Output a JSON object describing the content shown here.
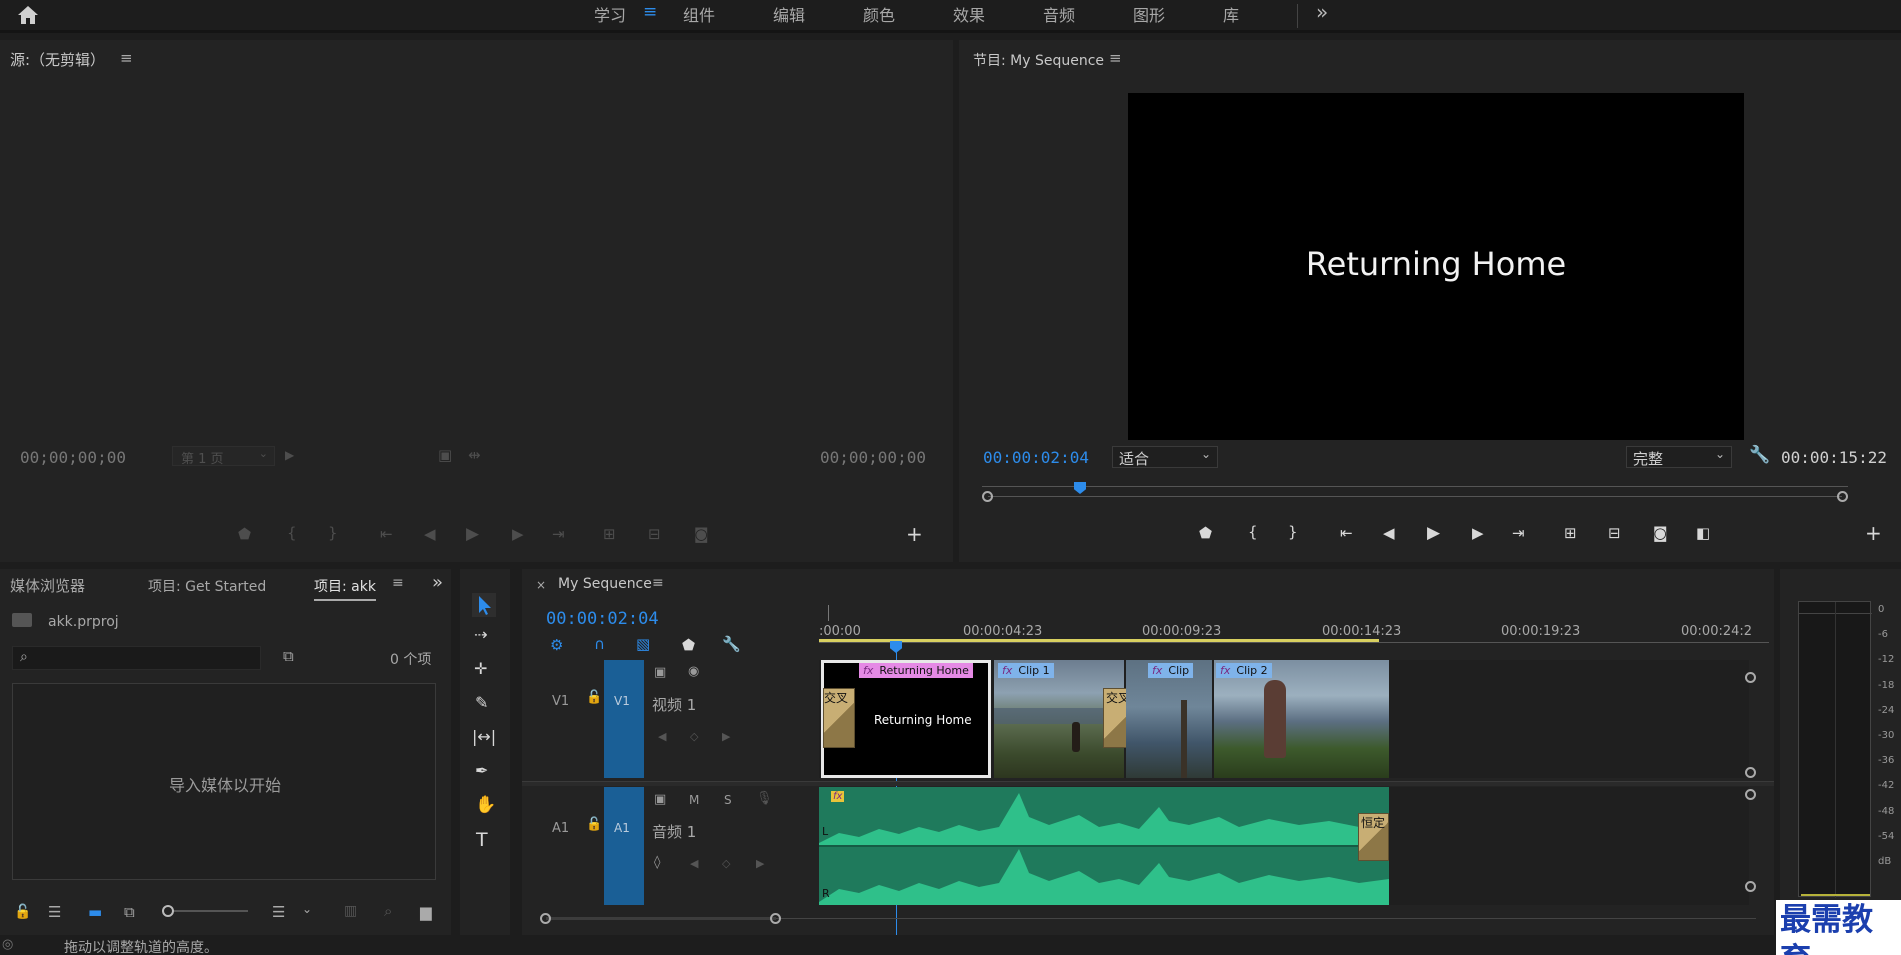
{
  "topbar": {
    "workspaces": [
      "学习",
      "组件",
      "编辑",
      "颜色",
      "效果",
      "音频",
      "图形",
      "库"
    ],
    "active_workspace": "学习",
    "overflow": "»"
  },
  "source_panel": {
    "title": "源:（无剪辑）",
    "timecode_in": "00;00;00;00",
    "page_select": "第 1 页",
    "timecode_out": "00;00;00;00"
  },
  "program_panel": {
    "title": "节目: My Sequence",
    "preview_text": "Returning Home",
    "timecode": "00:00:02:04",
    "fit_select": "适合",
    "quality_select": "完整",
    "duration": "00:00:15:22"
  },
  "project_panel": {
    "tabs": [
      "媒体浏览器",
      "项目: Get Started",
      "项目: akk"
    ],
    "active_tab": "项目: akk",
    "file_name": "akk.prproj",
    "search_placeholder": "",
    "item_count": "0 个项",
    "empty_message": "导入媒体以开始"
  },
  "timeline": {
    "tab_title": "My Sequence",
    "timecode": "00:00:02:04",
    "ruler_labels": [
      ":00:00",
      "00:00:04:23",
      "00:00:09:23",
      "00:00:14:23",
      "00:00:19:23",
      "00:00:24:2"
    ],
    "tracks": {
      "v1": {
        "label": "V1",
        "target": "V1",
        "name": "视频 1"
      },
      "a1": {
        "label": "A1",
        "target": "A1",
        "name": "音频 1",
        "m": "M",
        "s": "S",
        "left": "L",
        "right": "R"
      }
    },
    "clips": {
      "title_clip": "Returning Home",
      "title_clip_text": "Returning Home",
      "clip1": "Clip 1",
      "clip_mid": "Clip",
      "clip2": "Clip 2",
      "transition_1": "交叉",
      "transition_2": "交叉溶",
      "audio_transition": "恒定",
      "fx": "fx"
    }
  },
  "meter": {
    "scale": [
      "0",
      "-6",
      "-12",
      "-18",
      "-24",
      "-30",
      "-36",
      "-42",
      "-48",
      "-54",
      "dB"
    ]
  },
  "status_bar": {
    "message": "拖动以调整轨道的高度。"
  },
  "watermark": "最需教育",
  "colors": {
    "accent_blue": "#2d8ceb",
    "track_target": "#1a5f96",
    "audio_green": "#2fc08a",
    "title_clip_label": "#e58ae5",
    "video_clip_label": "#7fb3ea",
    "transition": "#a08a5a"
  }
}
